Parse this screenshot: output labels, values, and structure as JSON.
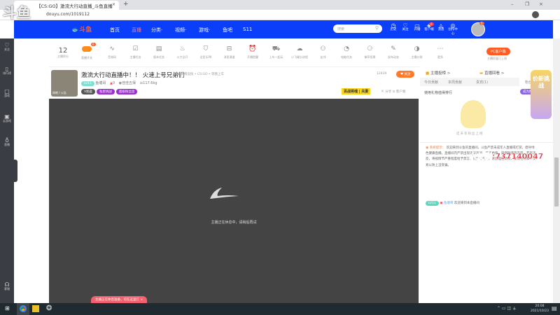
{
  "browser": {
    "tab_title": "【CS:GO】激流大行动直播_斗鱼直播",
    "url": "douyu.com/1019112",
    "logo_watermark": "斗鱼"
  },
  "nav": {
    "items": [
      "首页",
      "直播",
      "分类·",
      "视频·",
      "游戏·",
      "鱼吧",
      "S11"
    ],
    "search_placeholder": "搜索",
    "icons": [
      {
        "label": "历史",
        "icon": "clock-icon",
        "glyph": "◷"
      },
      {
        "label": "关注",
        "icon": "heart-icon",
        "glyph": "♡"
      },
      {
        "label": "开播",
        "icon": "camera-icon",
        "glyph": "▭"
      },
      {
        "label": "客户端",
        "icon": "client-icon",
        "glyph": "◈"
      },
      {
        "label": "消息",
        "icon": "bell-icon",
        "glyph": "◬"
      },
      {
        "label": "创作中心",
        "icon": "bulb-icon",
        "glyph": "◎"
      }
    ],
    "avatar_badge": "5",
    "client_badge": "6"
  },
  "sidebar": [
    {
      "label": "关注",
      "icon": "heart-icon",
      "glyph": "♡"
    },
    {
      "label": "排行榜",
      "icon": "rank-icon",
      "glyph": "▯"
    },
    {
      "label": "游戏",
      "icon": "game-icon",
      "glyph": "▢"
    },
    {
      "label": "云游戏",
      "icon": "cloud-game-icon",
      "glyph": "▣"
    },
    {
      "label": "直播",
      "icon": "live-icon",
      "glyph": "♁"
    },
    {
      "label": "客服",
      "icon": "service-icon",
      "glyph": "☊"
    }
  ],
  "toolbar": {
    "score": "12",
    "score_label": "主播积分",
    "switch_label": "直播开关",
    "switch_badge": "6",
    "tools": [
      {
        "label": "音效码",
        "glyph": "∿"
      },
      {
        "label": "主播任务",
        "glyph": "☑"
      },
      {
        "label": "版本任务",
        "glyph": "▤"
      },
      {
        "label": "火力全开",
        "glyph": "♨"
      },
      {
        "label": "全民乐PK",
        "glyph": "⛉"
      },
      {
        "label": "消息通道",
        "glyph": "⊟"
      },
      {
        "label": "开播提醒",
        "glyph": "⏰"
      },
      {
        "label": "上车一起玩",
        "glyph": "⛟"
      },
      {
        "label": "小飞碟分进程",
        "glyph": "☁"
      },
      {
        "label": "友邻",
        "glyph": "⚇"
      },
      {
        "label": "电能任务",
        "glyph": "◔"
      },
      {
        "label": "掌声投票",
        "glyph": "⚆"
      },
      {
        "label": "发布动态",
        "glyph": "✎"
      },
      {
        "label": "主播口袋",
        "glyph": "◑"
      },
      {
        "label": "更多",
        "glyph": "⋯"
      }
    ],
    "pc_client": "PC客户端",
    "pc_note": "主播投鉴已上线"
  },
  "room": {
    "title": "激流大行动直播中！！ 火速上号兄弟们",
    "report": "举报",
    "category": "网络竞技 • CS:GO • 等我上车",
    "level_badge": "LV11",
    "anchor": "鱼塘哥",
    "hot": "0",
    "location": "佳佳五保",
    "weight": "117.6kg",
    "tags": [
      "V图鉴",
      "粘星挑战",
      "超级粉丝团"
    ],
    "avatar_caption": "网吧 / 公告",
    "follow_count": "12439",
    "follow_label": "关注",
    "banner": "百战将魂 | 夫妻",
    "share": "分享",
    "screenshot": "客户端"
  },
  "video": {
    "status": "主播正在休息中，请稍后再试",
    "toast": "主播正在休息准备，可在这里打"
  },
  "right": {
    "rank_label": "主播投榜 >",
    "replay_label": "直播回看 >",
    "tabs": [
      "今日贡献",
      "本周贡献",
      "贵宾(1)",
      "粉丝(0)"
    ],
    "rank_empty": "使用礼物值得排行",
    "become_fan": "成为粉丝",
    "empty_text": "还未有粉丝上榜",
    "system_title": "系统提示：",
    "system_msg": "欢迎来到斗鱼的直播间，斗鱼严禁未成年人直播或打赏，倡导绿色健康直播。直播间内严禁出现违法违规、低俗色情、吸烟酗酒等内容，若有违反，将视情节严重程度给予禁言、封禁等处罚。请您理性消费，警惕任何私下交易以防上当受骗。",
    "watermark": "水友群:737140047",
    "welcome_badge": "LV11",
    "welcome_user": "鱼塘哥",
    "welcome_text": "欢迎来到本直播间",
    "promo": "价新挑战"
  },
  "taskbar": {
    "time": "20:08",
    "date": "2021/10/23"
  }
}
